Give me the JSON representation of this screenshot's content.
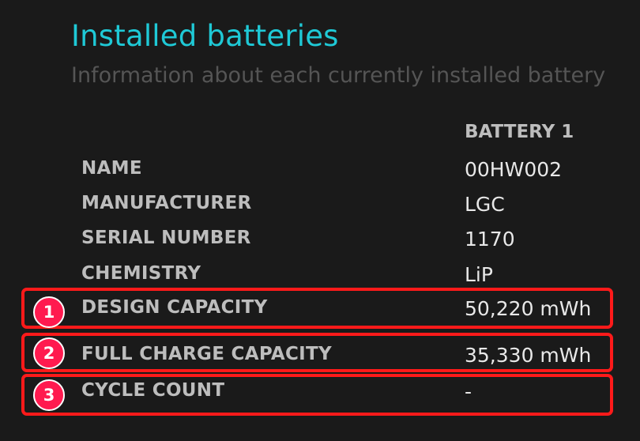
{
  "header": {
    "title": "Installed batteries",
    "subtitle": "Information about each currently installed battery"
  },
  "table": {
    "column_header": "BATTERY 1",
    "rows": [
      {
        "label": "NAME",
        "value": "00HW002"
      },
      {
        "label": "MANUFACTURER",
        "value": "LGC"
      },
      {
        "label": "SERIAL NUMBER",
        "value": "1170"
      },
      {
        "label": "CHEMISTRY",
        "value": "LiP"
      },
      {
        "label": "DESIGN CAPACITY",
        "value": "50,220 mWh"
      },
      {
        "label": "FULL CHARGE CAPACITY",
        "value": "35,330 mWh"
      },
      {
        "label": "CYCLE COUNT",
        "value": "-"
      }
    ]
  },
  "annotations": {
    "badges": [
      "1",
      "2",
      "3"
    ],
    "highlight_color": "#ff1a1a"
  },
  "colors": {
    "background": "#1a1a1a",
    "title": "#1fc9d6",
    "subtitle": "#555555",
    "label": "#bdbdbd",
    "value": "#e8e8e8"
  }
}
